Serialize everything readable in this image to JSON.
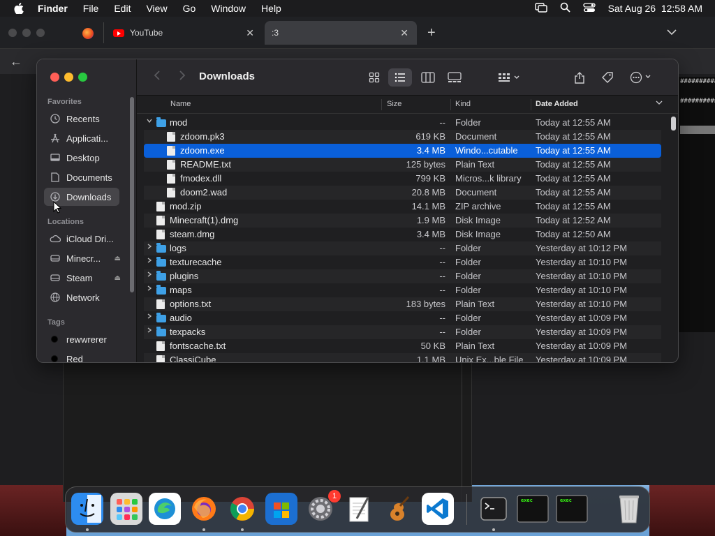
{
  "menubar": {
    "app_name": "Finder",
    "items": [
      "File",
      "Edit",
      "View",
      "Go",
      "Window",
      "Help"
    ],
    "clock": "Sat Aug 26  12:58 AM",
    "icons": [
      "screen-mirroring-icon",
      "spotlight-icon",
      "control-center-icon"
    ]
  },
  "browser": {
    "tabs": [
      {
        "label": "YouTube",
        "icon": "youtube-icon"
      },
      {
        "label": ":3",
        "active": true
      }
    ],
    "terminal_lines": [
      "##########",
      "##########"
    ]
  },
  "finder": {
    "title": "Downloads",
    "sidebar": {
      "favorites_label": "Favorites",
      "favorites": [
        {
          "label": "Recents",
          "icon": "clock-icon"
        },
        {
          "label": "Applicati...",
          "icon": "applications-icon"
        },
        {
          "label": "Desktop",
          "icon": "desktop-icon"
        },
        {
          "label": "Documents",
          "icon": "document-icon"
        },
        {
          "label": "Downloads",
          "icon": "download-icon",
          "selected": true
        }
      ],
      "locations_label": "Locations",
      "locations": [
        {
          "label": "iCloud Dri...",
          "icon": "cloud-icon"
        },
        {
          "label": "Minecr...",
          "icon": "disk-icon",
          "eject": true
        },
        {
          "label": "Steam",
          "icon": "disk-icon",
          "eject": true
        },
        {
          "label": "Network",
          "icon": "network-icon"
        }
      ],
      "tags_label": "Tags",
      "tags": [
        {
          "label": "rewwrerer",
          "color": "#000000"
        },
        {
          "label": "Red",
          "color": "#000000"
        }
      ]
    },
    "columns": {
      "name": "Name",
      "size": "Size",
      "kind": "Kind",
      "date": "Date Added"
    },
    "files": [
      {
        "name": "mod",
        "size": "--",
        "kind": "Folder",
        "date": "Today at 12:55 AM",
        "type": "folder",
        "level": 0,
        "expanded": true
      },
      {
        "name": "zdoom.pk3",
        "size": "619 KB",
        "kind": "Document",
        "date": "Today at 12:55 AM",
        "type": "doc",
        "level": 1
      },
      {
        "name": "zdoom.exe",
        "size": "3.4 MB",
        "kind": "Windo...cutable",
        "date": "Today at 12:55 AM",
        "type": "doc",
        "level": 1,
        "selected": true
      },
      {
        "name": "README.txt",
        "size": "125 bytes",
        "kind": "Plain Text",
        "date": "Today at 12:55 AM",
        "type": "doc",
        "level": 1
      },
      {
        "name": "fmodex.dll",
        "size": "799 KB",
        "kind": "Micros...k library",
        "date": "Today at 12:55 AM",
        "type": "doc",
        "level": 1
      },
      {
        "name": "doom2.wad",
        "size": "20.8 MB",
        "kind": "Document",
        "date": "Today at 12:55 AM",
        "type": "doc",
        "level": 1
      },
      {
        "name": "mod.zip",
        "size": "14.1 MB",
        "kind": "ZIP archive",
        "date": "Today at 12:55 AM",
        "type": "doc",
        "level": 0
      },
      {
        "name": "Minecraft(1).dmg",
        "size": "1.9 MB",
        "kind": "Disk Image",
        "date": "Today at 12:52 AM",
        "type": "doc",
        "level": 0
      },
      {
        "name": "steam.dmg",
        "size": "3.4 MB",
        "kind": "Disk Image",
        "date": "Today at 12:50 AM",
        "type": "doc",
        "level": 0
      },
      {
        "name": "logs",
        "size": "--",
        "kind": "Folder",
        "date": "Yesterday at 10:12 PM",
        "type": "folder",
        "level": 0,
        "expandable": true
      },
      {
        "name": "texturecache",
        "size": "--",
        "kind": "Folder",
        "date": "Yesterday at 10:10 PM",
        "type": "folder",
        "level": 0,
        "expandable": true
      },
      {
        "name": "plugins",
        "size": "--",
        "kind": "Folder",
        "date": "Yesterday at 10:10 PM",
        "type": "folder",
        "level": 0,
        "expandable": true
      },
      {
        "name": "maps",
        "size": "--",
        "kind": "Folder",
        "date": "Yesterday at 10:10 PM",
        "type": "folder",
        "level": 0,
        "expandable": true
      },
      {
        "name": "options.txt",
        "size": "183 bytes",
        "kind": "Plain Text",
        "date": "Yesterday at 10:10 PM",
        "type": "doc",
        "level": 0
      },
      {
        "name": "audio",
        "size": "--",
        "kind": "Folder",
        "date": "Yesterday at 10:09 PM",
        "type": "folder",
        "level": 0,
        "expandable": true
      },
      {
        "name": "texpacks",
        "size": "--",
        "kind": "Folder",
        "date": "Yesterday at 10:09 PM",
        "type": "folder",
        "level": 0,
        "expandable": true
      },
      {
        "name": "fontscache.txt",
        "size": "50 KB",
        "kind": "Plain Text",
        "date": "Yesterday at 10:09 PM",
        "type": "doc",
        "level": 0
      },
      {
        "name": "ClassiCube",
        "size": "1.1 MB",
        "kind": "Unix Ex...ble File",
        "date": "Yesterday at 10:09 PM",
        "type": "doc",
        "level": 0
      }
    ],
    "toolbar_icons": [
      "icon-view-icon",
      "list-view-icon",
      "column-view-icon",
      "gallery-view-icon",
      "group-icon",
      "share-icon",
      "tag-icon",
      "more-icon",
      "search-icon"
    ]
  },
  "dock": {
    "apps": [
      {
        "name": "finder-icon",
        "running": true,
        "color": "#2d8cf0"
      },
      {
        "name": "launchpad-icon",
        "running": false,
        "color": "#d9d9d9"
      },
      {
        "name": "edge-icon",
        "running": false,
        "color": "#ffffff"
      },
      {
        "name": "firefox-icon",
        "running": true,
        "color": "#ff7a18"
      },
      {
        "name": "chrome-icon",
        "running": true,
        "color": "#ffffff"
      },
      {
        "name": "microsoft-store-icon",
        "running": false,
        "color": "#1c6fd1"
      },
      {
        "name": "system-settings-icon",
        "running": false,
        "color": "#8e8e93",
        "badge": "1"
      },
      {
        "name": "textedit-icon",
        "running": false,
        "color": "#f2f2f2"
      },
      {
        "name": "garageband-icon",
        "running": false,
        "color": "#3a2a1a"
      },
      {
        "name": "vscode-icon",
        "running": false,
        "color": "#ffffff"
      },
      {
        "name": "terminal-icon",
        "running": true,
        "color": "#1c1c1e"
      },
      {
        "name": "exec-icon",
        "running": false,
        "color": "#1c1c1e",
        "label": "exec"
      },
      {
        "name": "exec-icon",
        "running": false,
        "color": "#1c1c1e",
        "label": "exec"
      },
      {
        "name": "trash-icon",
        "running": false,
        "color": "#bdbdbd"
      }
    ]
  }
}
